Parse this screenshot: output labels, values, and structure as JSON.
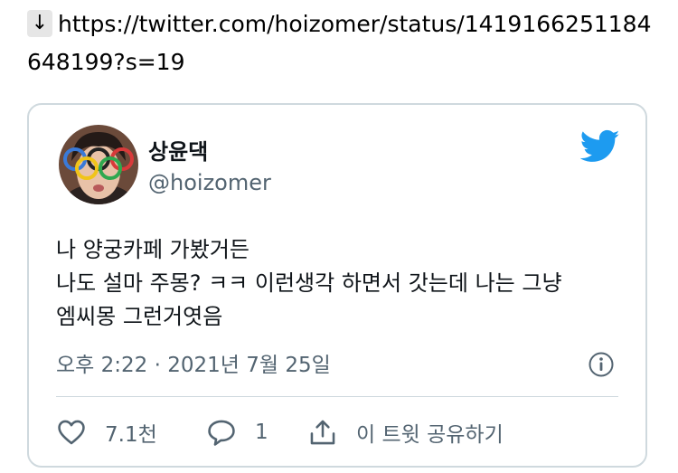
{
  "link": {
    "icon": "down-arrow-icon",
    "url": "https://twitter.com/hoizomer/status/1419166251184648199?s=19"
  },
  "tweet": {
    "author_name": "상윤댁",
    "author_handle": "@hoizomer",
    "brand_icon": "twitter-bird-icon",
    "brand_color": "#1d9bf0",
    "lines": [
      "나 양궁카페 가봤거든",
      "나도 설마 주몽? ㅋㅋ 이런생각 하면서 갓는데 나는 그냥",
      "엠씨몽 그런거엿음"
    ],
    "timestamp": "오후 2:22 · 2021년 7월 25일",
    "actions": {
      "like_count": "7.1천",
      "reply_count": "1",
      "share_label": "이 트윗 공유하기"
    }
  }
}
